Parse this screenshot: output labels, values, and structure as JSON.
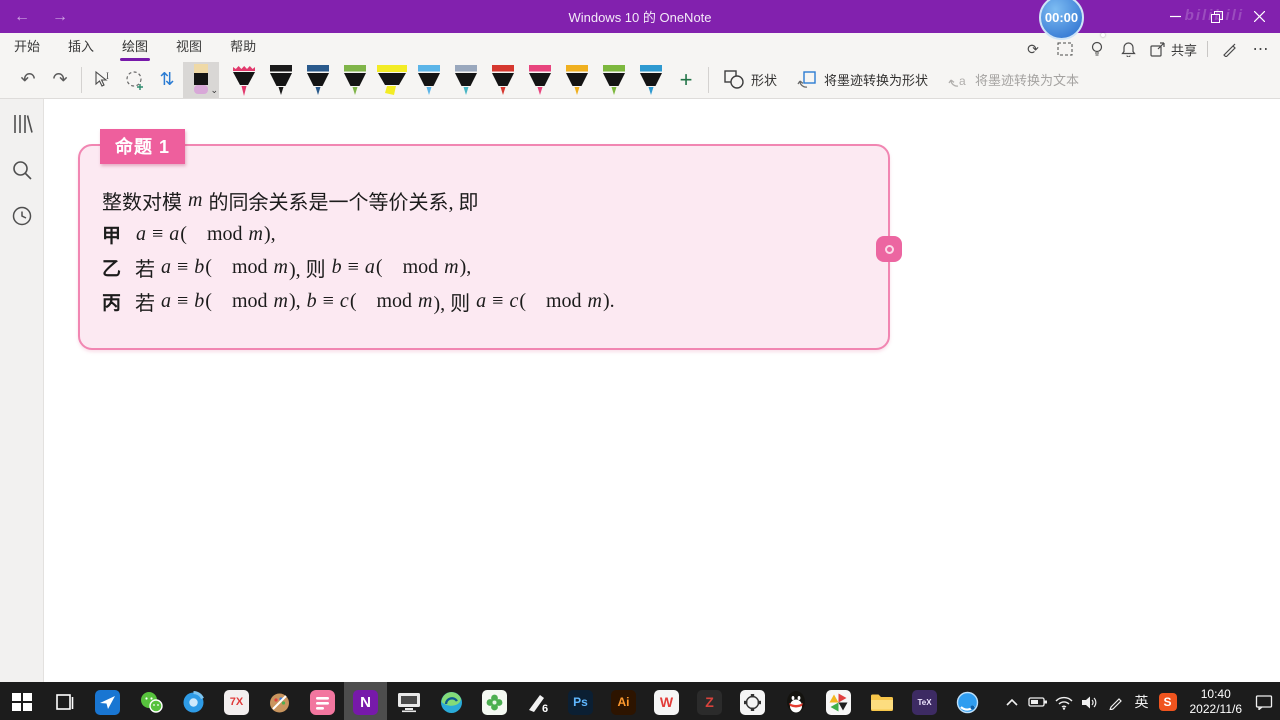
{
  "colors": {
    "titlebar": "#8221ae",
    "accent": "#7719aa",
    "pink_border": "#f186b2",
    "pink_fill": "#fce9f2",
    "badge_bg": "#ee5f9d",
    "taskbar": "#1c1c1c",
    "timer_blue": "#3c7fd6"
  },
  "titlebar": {
    "title": "Windows 10 的 OneNote",
    "timer": "00:00",
    "watermark": "bilibili"
  },
  "ribbon": {
    "tabs": [
      {
        "label": "开始",
        "active": false
      },
      {
        "label": "插入",
        "active": false
      },
      {
        "label": "绘图",
        "active": true
      },
      {
        "label": "视图",
        "active": false
      },
      {
        "label": "帮助",
        "active": false
      }
    ],
    "share_label": "共享",
    "more_label": "⋯",
    "undo_glyph": "↶",
    "redo_glyph": "↷",
    "sync_glyph": "⟳",
    "insert_space_glyph": "⇅",
    "plus_glyph": "+",
    "eraser_chevron": "⌄",
    "shapes_label": "形状",
    "convert_shape_label": "将墨迹转换为形状",
    "convert_text_label": "将墨迹转换为文本",
    "pens": [
      {
        "name": "pencil-crimson",
        "kind": "pencil",
        "color": "#e23a6d"
      },
      {
        "name": "pen-black",
        "kind": "pen",
        "color": "#1b1b1b"
      },
      {
        "name": "pen-navy",
        "kind": "pen",
        "color": "#2a5a8c"
      },
      {
        "name": "pen-green",
        "kind": "pen",
        "color": "#80b549"
      },
      {
        "name": "highlighter-yellow",
        "kind": "highlighter",
        "color": "#f3ec25"
      },
      {
        "name": "pen-sky-blue",
        "kind": "pen",
        "color": "#5cb5e8"
      },
      {
        "name": "pen-galaxy",
        "kind": "pen",
        "color": "#9aa8bd",
        "tip": "#49b6c4"
      },
      {
        "name": "pen-red",
        "kind": "pen",
        "color": "#d6382f"
      },
      {
        "name": "pen-magenta",
        "kind": "pen",
        "color": "#e8457e"
      },
      {
        "name": "pen-amber",
        "kind": "pen",
        "color": "#f0b01f"
      },
      {
        "name": "pen-lime",
        "kind": "pen",
        "color": "#7db83e"
      },
      {
        "name": "pen-blue",
        "kind": "pen",
        "color": "#2f9ad1"
      }
    ]
  },
  "content": {
    "badge": "命题 1",
    "lines": [
      {
        "label": "",
        "segments": [
          {
            "text": "整数对模 "
          },
          {
            "text": "m",
            "math": true
          },
          {
            "text": " 的同余关系是一个等价关系, 即"
          }
        ]
      },
      {
        "label": "甲",
        "segments": [
          {
            "text": "a",
            "math": true
          },
          {
            "text": " ≡ "
          },
          {
            "text": "a",
            "math": true
          },
          {
            "text": "( mod "
          },
          {
            "text": "m",
            "math": true
          },
          {
            "text": "),"
          }
        ]
      },
      {
        "label": "乙",
        "segments": [
          {
            "text": "若 "
          },
          {
            "text": "a",
            "math": true
          },
          {
            "text": " ≡ "
          },
          {
            "text": "b",
            "math": true
          },
          {
            "text": "( mod "
          },
          {
            "text": "m",
            "math": true
          },
          {
            "text": "), 则 "
          },
          {
            "text": "b",
            "math": true
          },
          {
            "text": " ≡ "
          },
          {
            "text": "a",
            "math": true
          },
          {
            "text": "( mod "
          },
          {
            "text": "m",
            "math": true
          },
          {
            "text": "),"
          }
        ]
      },
      {
        "label": "丙",
        "segments": [
          {
            "text": "若 "
          },
          {
            "text": "a",
            "math": true
          },
          {
            "text": " ≡ "
          },
          {
            "text": "b",
            "math": true
          },
          {
            "text": "( mod "
          },
          {
            "text": "m",
            "math": true
          },
          {
            "text": "), "
          },
          {
            "text": "b",
            "math": true
          },
          {
            "text": " ≡ "
          },
          {
            "text": "c",
            "math": true
          },
          {
            "text": "( mod "
          },
          {
            "text": "m",
            "math": true
          },
          {
            "text": "), 则 "
          },
          {
            "text": "a",
            "math": true
          },
          {
            "text": " ≡ "
          },
          {
            "text": "c",
            "math": true
          },
          {
            "text": "( mod "
          },
          {
            "text": "m",
            "math": true
          },
          {
            "text": ")."
          }
        ]
      }
    ]
  },
  "taskbar": {
    "items": [
      {
        "name": "start-button",
        "icon": "start"
      },
      {
        "name": "task-view-button",
        "icon": "taskview"
      },
      {
        "name": "messenger-app",
        "icon": "plane"
      },
      {
        "name": "wechat-app",
        "icon": "wechat"
      },
      {
        "name": "browser-360-app",
        "icon": "swirl"
      },
      {
        "name": "7x-app",
        "icon": "tile",
        "text": "7X",
        "bg": "#f3efef",
        "fg": "#e03a3a",
        "fs": "11"
      },
      {
        "name": "paint-app",
        "icon": "palette"
      },
      {
        "name": "pink-dict-app",
        "icon": "pinkapp"
      },
      {
        "name": "onenote-app",
        "icon": "tile",
        "text": "N",
        "bg": "#7719aa",
        "fg": "#ffffff",
        "fs": "15",
        "active": true
      },
      {
        "name": "screen-monitor-app",
        "icon": "monitor"
      },
      {
        "name": "edge-browser",
        "icon": "edge"
      },
      {
        "name": "clover-app",
        "icon": "clover"
      },
      {
        "name": "tablet-driver-app",
        "icon": "pen6",
        "text": "6"
      },
      {
        "name": "photoshop-app",
        "icon": "tile",
        "text": "Ps",
        "bg": "#0b1f33",
        "fg": "#5fb7ff",
        "fs": "12"
      },
      {
        "name": "illustrator-app",
        "icon": "tile",
        "text": "Ai",
        "bg": "#2d1400",
        "fg": "#ff9a2e",
        "fs": "12"
      },
      {
        "name": "wps-app",
        "icon": "tile",
        "text": "W",
        "bg": "#f5f5f5",
        "fg": "#e23c39",
        "fs": "14"
      },
      {
        "name": "z-app",
        "icon": "tile",
        "text": "Z",
        "bg": "#2b2b2b",
        "fg": "#d8433c",
        "fs": "14"
      },
      {
        "name": "network-app",
        "icon": "network"
      },
      {
        "name": "qq-app",
        "icon": "qq"
      },
      {
        "name": "pinwheel-app",
        "icon": "pinwheel"
      },
      {
        "name": "file-explorer",
        "icon": "folder"
      },
      {
        "name": "tex-app",
        "icon": "tile",
        "text": "TeX",
        "bg": "#3d2b63",
        "fg": "#efe7ff",
        "fs": "8"
      },
      {
        "name": "quark-browser",
        "icon": "quark"
      }
    ],
    "tray": {
      "ime": "英",
      "sogou": "S",
      "time": "10:40",
      "date": "2022/11/6"
    }
  }
}
